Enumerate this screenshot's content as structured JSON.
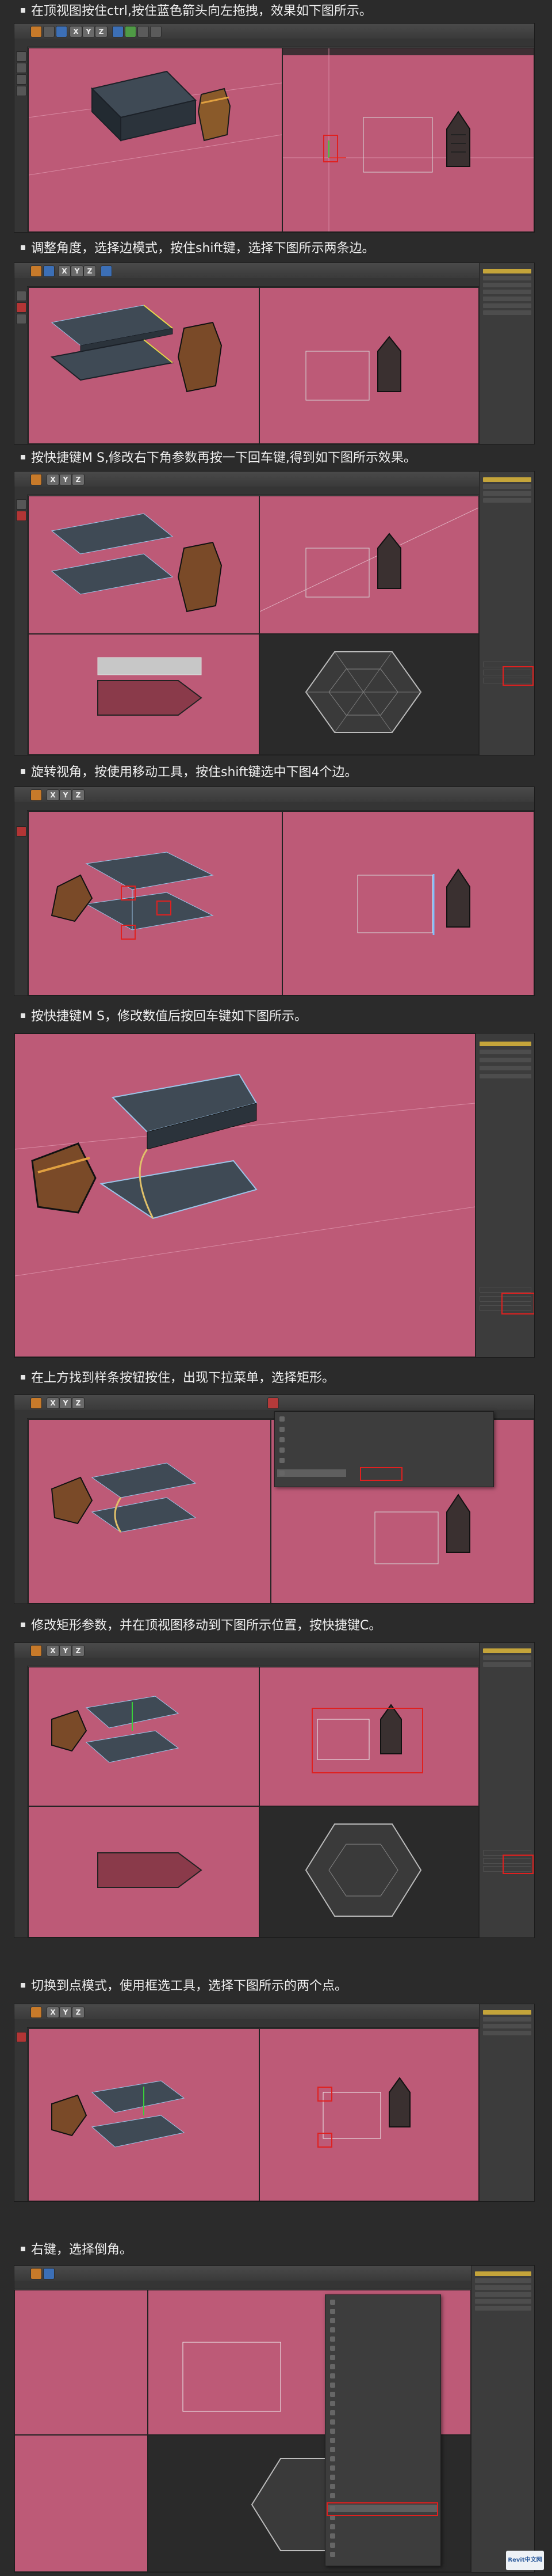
{
  "steps": [
    {
      "caption": "在顶视图按住ctrl,按住蓝色箭头向左拖拽，效果如下图所示。"
    },
    {
      "caption": "调整角度，选择边模式，按住shift键，选择下图所示两条边。"
    },
    {
      "caption": "按快捷键M S,修改右下角参数再按一下回车键,得到如下图所示效果。"
    },
    {
      "caption": "旋转视角，按使用移动工具，按住shift键选中下图4个边。"
    },
    {
      "caption": "按快捷键M S，修改数值后按回车键如下图所示。"
    },
    {
      "caption": "在上方找到样条按钮按住，出现下拉菜单，选择矩形。"
    },
    {
      "caption": "修改矩形参数，并在顶视图移动到下图所示位置，按快捷键C。"
    },
    {
      "caption": "切换到点模式，使用框选工具，选择下图所示的两个点。"
    },
    {
      "caption": "右键，选择倒角。"
    }
  ],
  "toolbar": {
    "x": "X",
    "y": "Y",
    "z": "Z"
  },
  "colors": {
    "viewport": "#bd5a77",
    "highlight": "#e0201f",
    "panel": "#3c3c3c",
    "accent": "#c4a43a"
  },
  "watermark": {
    "text": "Revit中文网"
  }
}
